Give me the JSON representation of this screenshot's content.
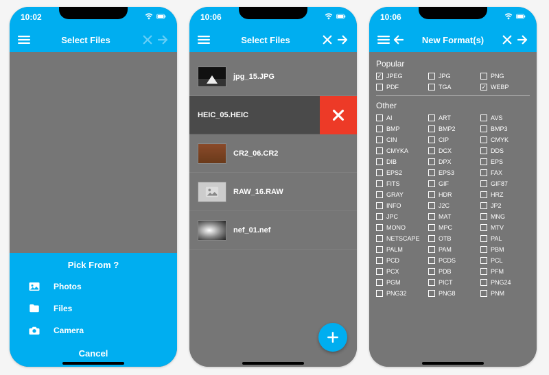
{
  "colors": {
    "accent": "#00aef0",
    "bg": "#767676",
    "delete": "#ed3a27"
  },
  "screen1": {
    "time": "10:02",
    "title": "Select Files",
    "sheet": {
      "heading": "Pick From ?",
      "options": [
        {
          "icon": "photo-icon",
          "label": "Photos"
        },
        {
          "icon": "folder-icon",
          "label": "Files"
        },
        {
          "icon": "camera-icon",
          "label": "Camera"
        }
      ],
      "cancel": "Cancel"
    }
  },
  "screen2": {
    "time": "10:06",
    "title": "Select Files",
    "files": [
      {
        "name": "jpg_15.JPG",
        "thumb": "img1"
      },
      {
        "name": "HEIC_05.HEIC",
        "thumb": "heic",
        "selected": true,
        "swipeDelete": true
      },
      {
        "name": "CR2_06.CR2",
        "thumb": "cr2"
      },
      {
        "name": "RAW_16.RAW",
        "thumb": "raw",
        "rawIcon": true
      },
      {
        "name": "nef_01.nef",
        "thumb": "nef"
      }
    ]
  },
  "screen3": {
    "time": "10:06",
    "title": "New Format(s)",
    "popular_label": "Popular",
    "popular": [
      {
        "name": "JPEG",
        "checked": true
      },
      {
        "name": "JPG",
        "checked": false
      },
      {
        "name": "PNG",
        "checked": false
      },
      {
        "name": "PDF",
        "checked": false
      },
      {
        "name": "TGA",
        "checked": false
      },
      {
        "name": "WEBP",
        "checked": true
      }
    ],
    "other_label": "Other",
    "other": [
      "AI",
      "ART",
      "AVS",
      "BMP",
      "BMP2",
      "BMP3",
      "CIN",
      "CIP",
      "CMYK",
      "CMYKA",
      "DCX",
      "DDS",
      "DIB",
      "DPX",
      "EPS",
      "EPS2",
      "EPS3",
      "FAX",
      "FITS",
      "GIF",
      "GIF87",
      "GRAY",
      "HDR",
      "HRZ",
      "INFO",
      "J2C",
      "JP2",
      "JPC",
      "MAT",
      "MNG",
      "MONO",
      "MPC",
      "MTV",
      "NETSCAPE",
      "OTB",
      "PAL",
      "PALM",
      "PAM",
      "PBM",
      "PCD",
      "PCDS",
      "PCL",
      "PCX",
      "PDB",
      "PFM",
      "PGM",
      "PICT",
      "PNG24",
      "PNG32",
      "PNG8",
      "PNM"
    ]
  }
}
